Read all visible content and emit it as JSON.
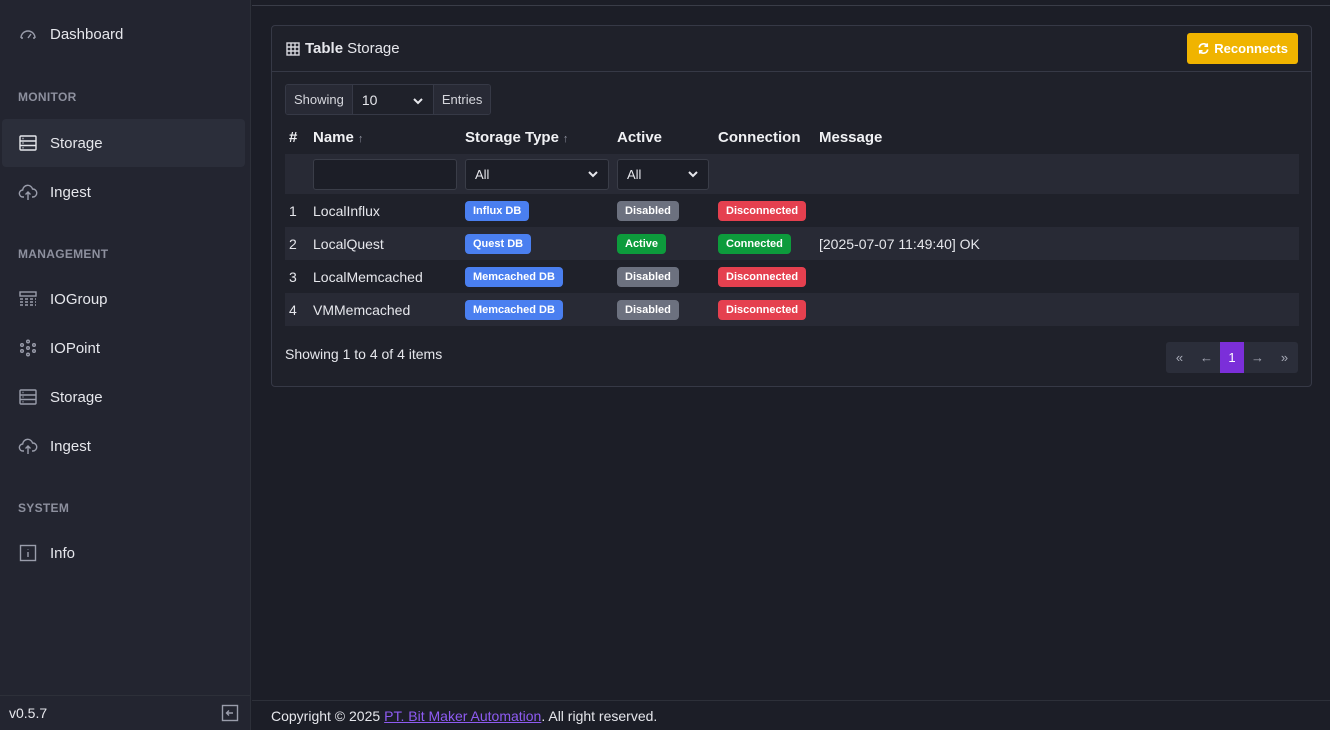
{
  "sidebar": {
    "dashboard": "Dashboard",
    "sections": {
      "monitor": "MONITOR",
      "management": "MANAGEMENT",
      "system": "SYSTEM"
    },
    "monitor_items": [
      "Storage",
      "Ingest"
    ],
    "management_items": [
      "IOGroup",
      "IOPoint",
      "Storage",
      "Ingest"
    ],
    "system_items": [
      "Info"
    ],
    "version": "v0.5.7"
  },
  "card": {
    "title_bold": "Table",
    "title_rest": "Storage",
    "reconnect_label": "Reconnects"
  },
  "entries": {
    "prefix": "Showing",
    "value": "10",
    "suffix": "Entries"
  },
  "table": {
    "headers": [
      "#",
      "Name",
      "Storage Type",
      "Active",
      "Connection",
      "Message"
    ],
    "filters": {
      "type": "All",
      "active": "All"
    },
    "rows": [
      {
        "num": "1",
        "name": "LocalInflux",
        "type": "Influx DB",
        "active": "Disabled",
        "connection": "Disconnected",
        "message": ""
      },
      {
        "num": "2",
        "name": "LocalQuest",
        "type": "Quest DB",
        "active": "Active",
        "connection": "Connected",
        "message": "[2025-07-07 11:49:40] OK"
      },
      {
        "num": "3",
        "name": "LocalMemcached",
        "type": "Memcached DB",
        "active": "Disabled",
        "connection": "Disconnected",
        "message": ""
      },
      {
        "num": "4",
        "name": "VMMemcached",
        "type": "Memcached DB",
        "active": "Disabled",
        "connection": "Disconnected",
        "message": ""
      }
    ]
  },
  "summary": "Showing 1 to 4 of 4 items",
  "pager": {
    "first": "«",
    "prev": "←",
    "current": "1",
    "next": "→",
    "last": "»"
  },
  "footer": {
    "prefix": "Copyright © 2025",
    "link": "PT. Bit Maker Automation",
    "suffix": ". All right reserved."
  },
  "colors": {
    "type_badge": "#4a7ff0",
    "disabled": "#6c717f",
    "active": "#0d9b3c",
    "disconnected": "#e5404f",
    "connected": "#0d9b3c",
    "accent": "#7b2fd9",
    "warning": "#f0b400"
  }
}
